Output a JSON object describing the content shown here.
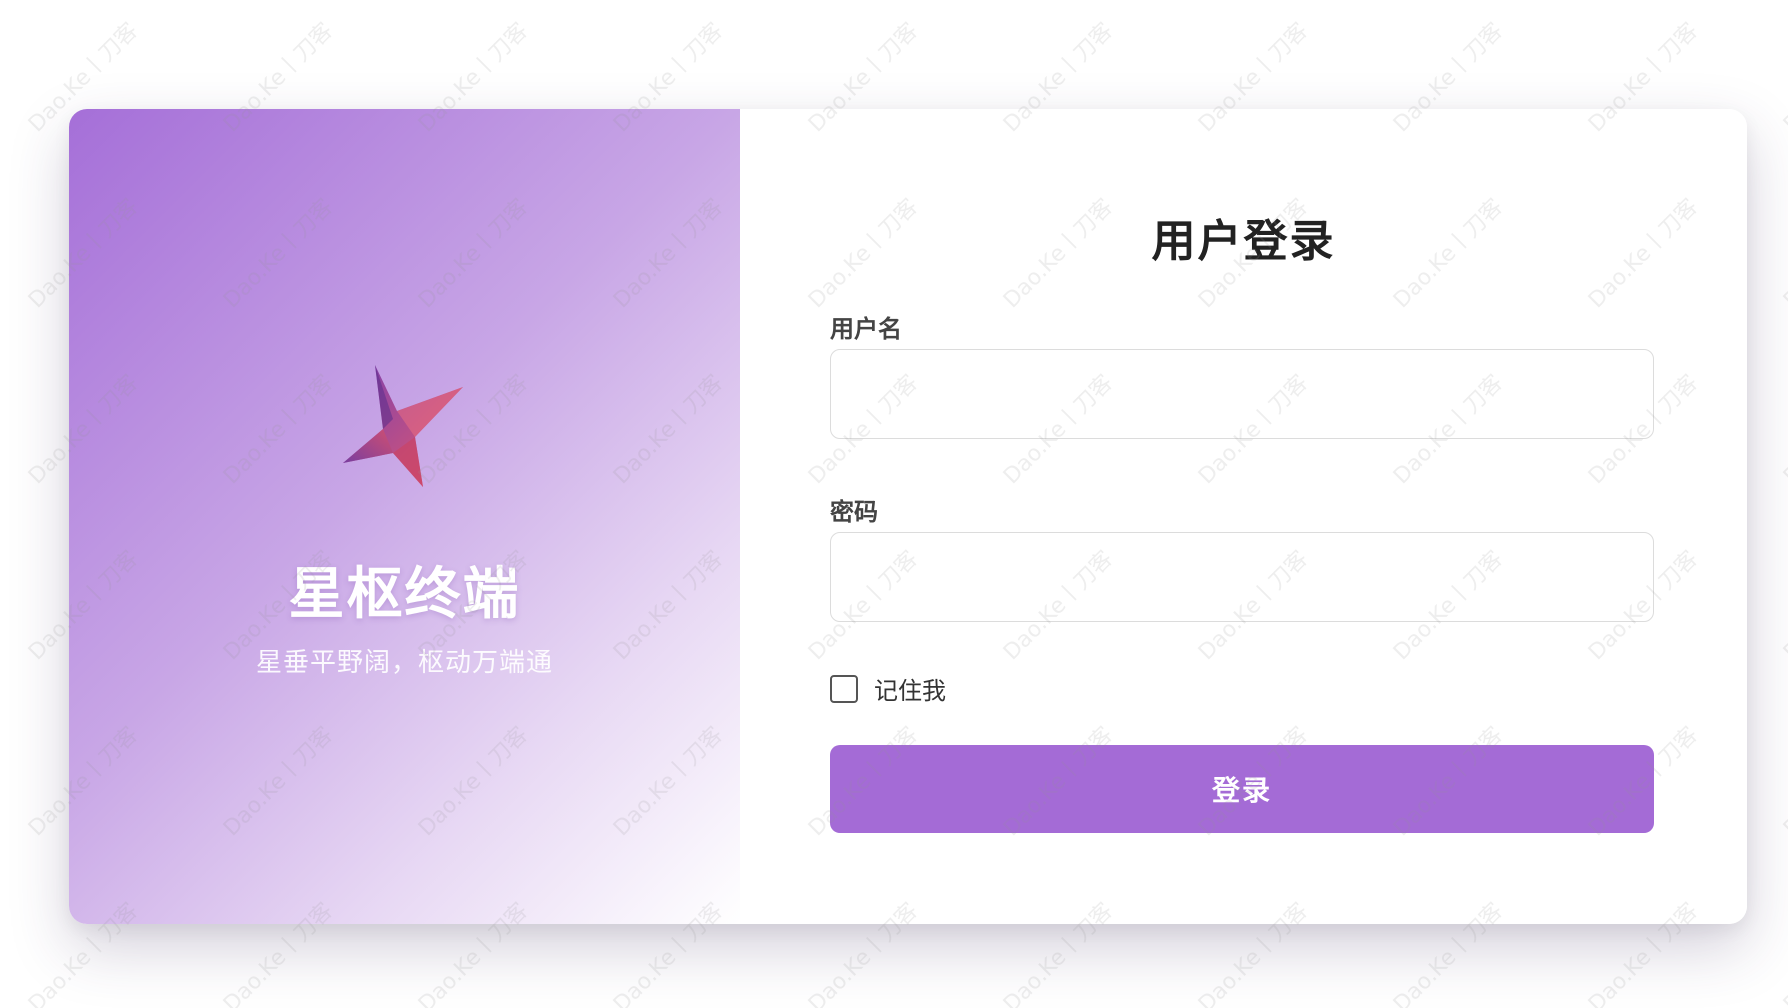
{
  "brand": {
    "name": "星枢终端",
    "slogan": "星垂平野阔，枢动万端通",
    "logo_icon": "star-logo-icon"
  },
  "login_form": {
    "title": "用户登录",
    "username_label": "用户名",
    "username_value": "",
    "password_label": "密码",
    "password_value": "",
    "remember_label": "记住我",
    "remember_checked": false,
    "submit_label": "登录"
  },
  "watermark": {
    "text": "Dao.Ke丨刀客"
  },
  "colors": {
    "accent": "#a46bd6",
    "gradient_start": "#a56fd8",
    "gradient_end": "#ffffff"
  }
}
